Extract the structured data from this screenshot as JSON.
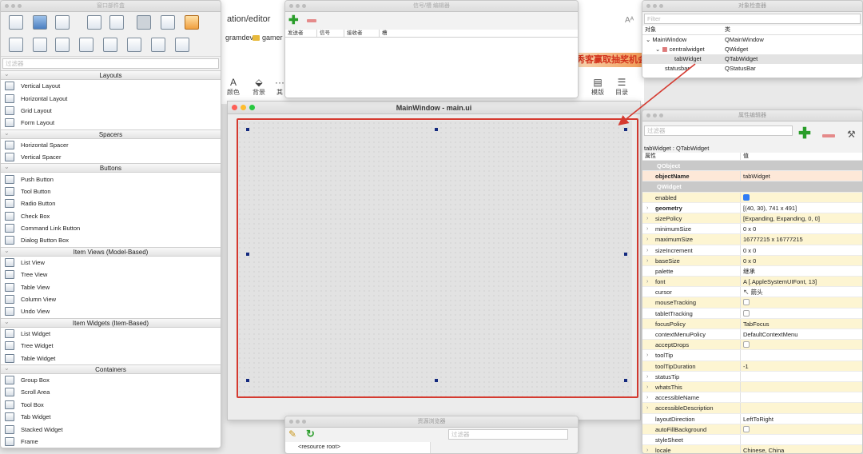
{
  "browser": {
    "address": "ation/editor",
    "aa": "Aᴬ",
    "bookmarks": [
      "gramdev",
      "gamer"
    ],
    "banner": "秀客赢取抽奖机会",
    "tools": [
      {
        "icon": "A",
        "label": "颜色"
      },
      {
        "icon": "⬙",
        "label": "背景"
      },
      {
        "icon": "···",
        "label": "其"
      }
    ],
    "tools_right": [
      {
        "icon": "▤",
        "label": "模版"
      },
      {
        "icon": "☰",
        "label": "目录"
      }
    ]
  },
  "widget_box": {
    "title": "窗口部件盒",
    "filter": "过滤器",
    "sections": [
      {
        "name": "Layouts",
        "items": [
          "Vertical Layout",
          "Horizontal Layout",
          "Grid Layout",
          "Form Layout"
        ]
      },
      {
        "name": "Spacers",
        "items": [
          "Horizontal Spacer",
          "Vertical Spacer"
        ]
      },
      {
        "name": "Buttons",
        "items": [
          "Push Button",
          "Tool Button",
          "Radio Button",
          "Check Box",
          "Command Link Button",
          "Dialog Button Box"
        ]
      },
      {
        "name": "Item Views (Model-Based)",
        "items": [
          "List View",
          "Tree View",
          "Table View",
          "Column View",
          "Undo View"
        ]
      },
      {
        "name": "Item Widgets (Item-Based)",
        "items": [
          "List Widget",
          "Tree Widget",
          "Table Widget"
        ]
      },
      {
        "name": "Containers",
        "items": [
          "Group Box",
          "Scroll Area",
          "Tool Box",
          "Tab Widget",
          "Stacked Widget",
          "Frame"
        ]
      }
    ]
  },
  "signal_editor": {
    "title": "信号/槽 编辑器",
    "columns": [
      "发送者",
      "信号",
      "接收者",
      "槽"
    ]
  },
  "main_window": {
    "title": "MainWindow - main.ui"
  },
  "object_inspector": {
    "title": "对象检查器",
    "filter": "Filter",
    "columns": [
      "对象",
      "类"
    ],
    "rows": [
      {
        "object": "MainWindow",
        "class": "QMainWindow"
      },
      {
        "object": "centralwidget",
        "class": "QWidget"
      },
      {
        "object": "tabWidget",
        "class": "QTabWidget"
      },
      {
        "object": "statusbar",
        "class": "QStatusBar"
      }
    ]
  },
  "property_editor": {
    "title": "属性编辑器",
    "filter": "过滤器",
    "context": "tabWidget : QTabWidget",
    "columns": [
      "属性",
      "值"
    ],
    "rows": [
      {
        "group": "QObject"
      },
      {
        "name": "objectName",
        "value": "tabWidget",
        "bold": true,
        "bg": "sel"
      },
      {
        "group": "QWidget"
      },
      {
        "name": "enabled",
        "check": true
      },
      {
        "name": "geometry",
        "value": "[(40, 30), 741 x 491]",
        "bold": true,
        "expand": true
      },
      {
        "name": "sizePolicy",
        "value": "[Expanding, Expanding, 0, 0]",
        "expand": true
      },
      {
        "name": "minimumSize",
        "value": "0 x 0",
        "expand": true
      },
      {
        "name": "maximumSize",
        "value": "16777215 x 16777215",
        "expand": true
      },
      {
        "name": "sizeIncrement",
        "value": "0 x 0",
        "expand": true
      },
      {
        "name": "baseSize",
        "value": "0 x 0",
        "expand": true
      },
      {
        "name": "palette",
        "value": "继承"
      },
      {
        "name": "font",
        "value": "A  [.AppleSystemUIFont, 13]",
        "expand": true
      },
      {
        "name": "cursor",
        "value": "↖  箭头"
      },
      {
        "name": "mouseTracking",
        "check": false
      },
      {
        "name": "tabletTracking",
        "check": false
      },
      {
        "name": "focusPolicy",
        "value": "TabFocus"
      },
      {
        "name": "contextMenuPolicy",
        "value": "DefaultContextMenu"
      },
      {
        "name": "acceptDrops",
        "check": false
      },
      {
        "name": "toolTip",
        "value": "",
        "expand": true
      },
      {
        "name": "toolTipDuration",
        "value": "-1"
      },
      {
        "name": "statusTip",
        "value": "",
        "expand": true
      },
      {
        "name": "whatsThis",
        "value": "",
        "expand": true
      },
      {
        "name": "accessibleName",
        "value": "",
        "expand": true
      },
      {
        "name": "accessibleDescription",
        "value": "",
        "expand": true
      },
      {
        "name": "layoutDirection",
        "value": "LeftToRight"
      },
      {
        "name": "autoFillBackground",
        "check": false
      },
      {
        "name": "styleSheet",
        "value": ""
      },
      {
        "name": "locale",
        "value": "Chinese, China",
        "expand": true
      }
    ]
  },
  "resource_browser": {
    "title": "资源浏览器",
    "filter": "过滤器",
    "root": "<resource root>"
  },
  "colors": {
    "highlight": "#d53a30",
    "selection_handle": "#142a7f",
    "row_alt": "#fdf5d2"
  }
}
